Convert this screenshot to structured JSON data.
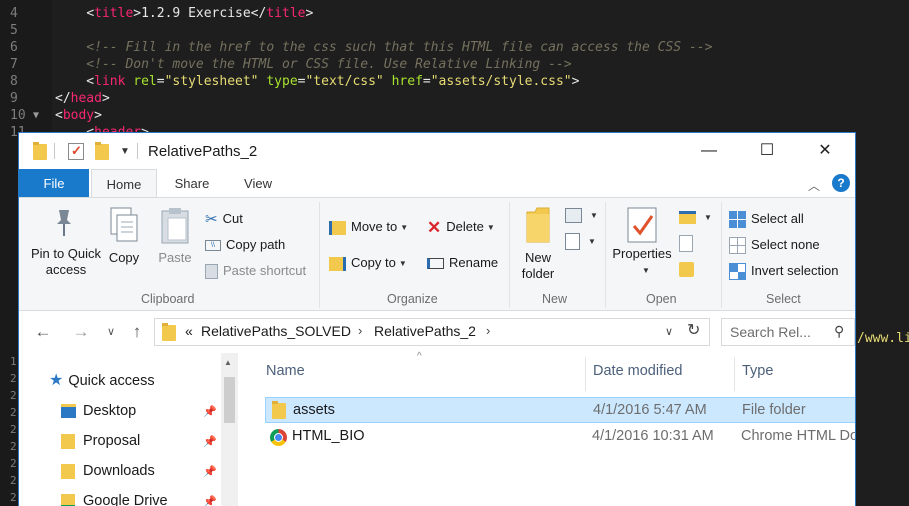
{
  "editor": {
    "lines": [
      {
        "num": "4",
        "segments": [
          {
            "t": "    ",
            "c": "pl"
          },
          {
            "t": "<",
            "c": "pl"
          },
          {
            "t": "title",
            "c": "tag"
          },
          {
            "t": ">1.2.9 Exercise</",
            "c": "pl"
          },
          {
            "t": "title",
            "c": "tag"
          },
          {
            "t": ">",
            "c": "pl"
          }
        ]
      },
      {
        "num": "5",
        "segments": []
      },
      {
        "num": "6",
        "segments": [
          {
            "t": "    <!-- Fill in the href to the css such that this HTML file can access the CSS -->",
            "c": "cmt"
          }
        ]
      },
      {
        "num": "7",
        "segments": [
          {
            "t": "    <!-- Don't move the HTML or CSS file. Use Relative Linking -->",
            "c": "cmt"
          }
        ]
      },
      {
        "num": "8",
        "segments": [
          {
            "t": "    <",
            "c": "pl"
          },
          {
            "t": "link",
            "c": "tag"
          },
          {
            "t": " rel",
            "c": "attr"
          },
          {
            "t": "=",
            "c": "pl"
          },
          {
            "t": "\"stylesheet\"",
            "c": "str"
          },
          {
            "t": " type",
            "c": "attr"
          },
          {
            "t": "=",
            "c": "pl"
          },
          {
            "t": "\"text/css\"",
            "c": "str"
          },
          {
            "t": " href",
            "c": "attr"
          },
          {
            "t": "=",
            "c": "pl"
          },
          {
            "t": "\"assets/style.css\"",
            "c": "str"
          },
          {
            "t": ">",
            "c": "pl"
          }
        ]
      },
      {
        "num": "9",
        "segments": [
          {
            "t": "</",
            "c": "pl"
          },
          {
            "t": "head",
            "c": "tag"
          },
          {
            "t": ">",
            "c": "pl"
          }
        ]
      },
      {
        "num": "10",
        "fold": "▼",
        "segments": [
          {
            "t": "<",
            "c": "pl"
          },
          {
            "t": "body",
            "c": "tag"
          },
          {
            "t": ">",
            "c": "pl"
          }
        ]
      },
      {
        "num": "11",
        "segments": [
          {
            "t": "    <",
            "c": "pl"
          },
          {
            "t": "header",
            "c": "tag"
          },
          {
            "t": ">",
            "c": "pl"
          }
        ]
      }
    ],
    "gutter_numbers": [
      "1",
      "2",
      "2",
      "2",
      "2",
      "2",
      "2",
      "2",
      "2",
      "2"
    ],
    "peek_text": "/www.lip"
  },
  "window": {
    "title": "RelativePaths_2",
    "controls": {
      "minimize": "—",
      "maximize": "☐",
      "close": "✕"
    }
  },
  "ribbon": {
    "tabs": {
      "file": "File",
      "home": "Home",
      "share": "Share",
      "view": "View"
    },
    "clipboard": {
      "pin": "Pin to Quick\naccess",
      "copy": "Copy",
      "paste": "Paste",
      "cut": "Cut",
      "copy_path": "Copy path",
      "paste_shortcut": "Paste shortcut",
      "group": "Clipboard"
    },
    "organize": {
      "move_to": "Move to",
      "copy_to": "Copy to",
      "delete": "Delete",
      "rename": "Rename",
      "group": "Organize"
    },
    "new": {
      "new_folder": "New\nfolder",
      "group": "New"
    },
    "open": {
      "properties": "Properties",
      "group": "Open"
    },
    "select": {
      "select_all": "Select all",
      "select_none": "Select none",
      "invert_selection": "Invert selection",
      "group": "Select"
    }
  },
  "address": {
    "overflow": "«",
    "crumbs": [
      "RelativePaths_SOLVED",
      "RelativePaths_2"
    ],
    "search_placeholder": "Search Rel..."
  },
  "navpane": {
    "quick_access": "Quick access",
    "items": [
      "Desktop",
      "Proposal",
      "Downloads",
      "Google Drive"
    ]
  },
  "files": {
    "columns": {
      "name": "Name",
      "date": "Date modified",
      "type": "Type"
    },
    "rows": [
      {
        "name": "assets",
        "date": "4/1/2016 5:47 AM",
        "type": "File folder",
        "icon": "folder-icon",
        "selected": true
      },
      {
        "name": "HTML_BIO",
        "date": "4/1/2016 10:31 AM",
        "type": "Chrome HTML Do",
        "icon": "chrome-icon",
        "selected": false
      }
    ]
  },
  "colors": {
    "accent": "#1979ca",
    "selection": "#cce8ff",
    "folder": "#f2c94c"
  }
}
